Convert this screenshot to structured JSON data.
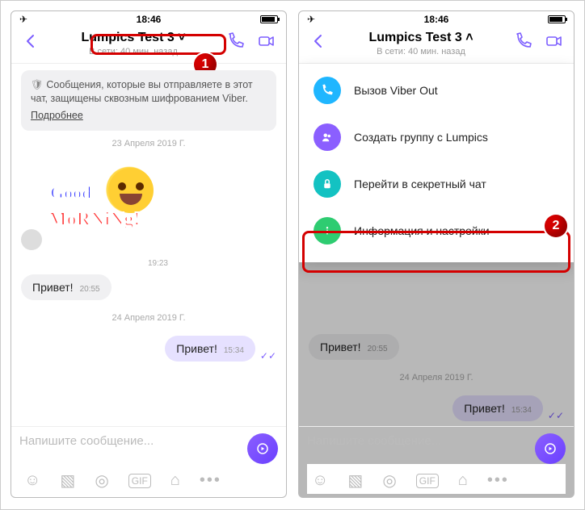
{
  "status": {
    "time": "18:46"
  },
  "left": {
    "title": "Lumpics Test 3",
    "chevron": "˅",
    "subtitle": "В сети: 40 мин. назад",
    "encryption": "Сообщения, которые вы отправляете в этот чат, защищены сквозным шифрованием Viber.",
    "encryption_more": "Подробнее",
    "date1": "23 Апреля 2019 Г.",
    "date2": "24 Апреля 2019 Г.",
    "sticker_line1": "Good",
    "sticker_line2": "MoRNiNg!",
    "sticker_time": "19:23",
    "msg_in": "Привет!",
    "msg_in_time": "20:55",
    "msg_out": "Привет!",
    "msg_out_time": "15:34",
    "placeholder": "Напишите сообщение..."
  },
  "right": {
    "title": "Lumpics Test 3",
    "chevron": "˄",
    "subtitle": "В сети: 40 мин. назад",
    "items": [
      {
        "label": "Вызов Viber Out"
      },
      {
        "label": "Создать группу с Lumpics"
      },
      {
        "label": "Перейти в секретный чат"
      },
      {
        "label": "Информация и настройки"
      }
    ],
    "msg_in": "Привет!",
    "msg_in_time": "20:55",
    "date2": "24 Апреля 2019 Г.",
    "msg_out": "Привет!",
    "msg_out_time": "15:34",
    "placeholder": "Напишите сообщение..."
  },
  "markers": {
    "one": "1",
    "two": "2"
  }
}
